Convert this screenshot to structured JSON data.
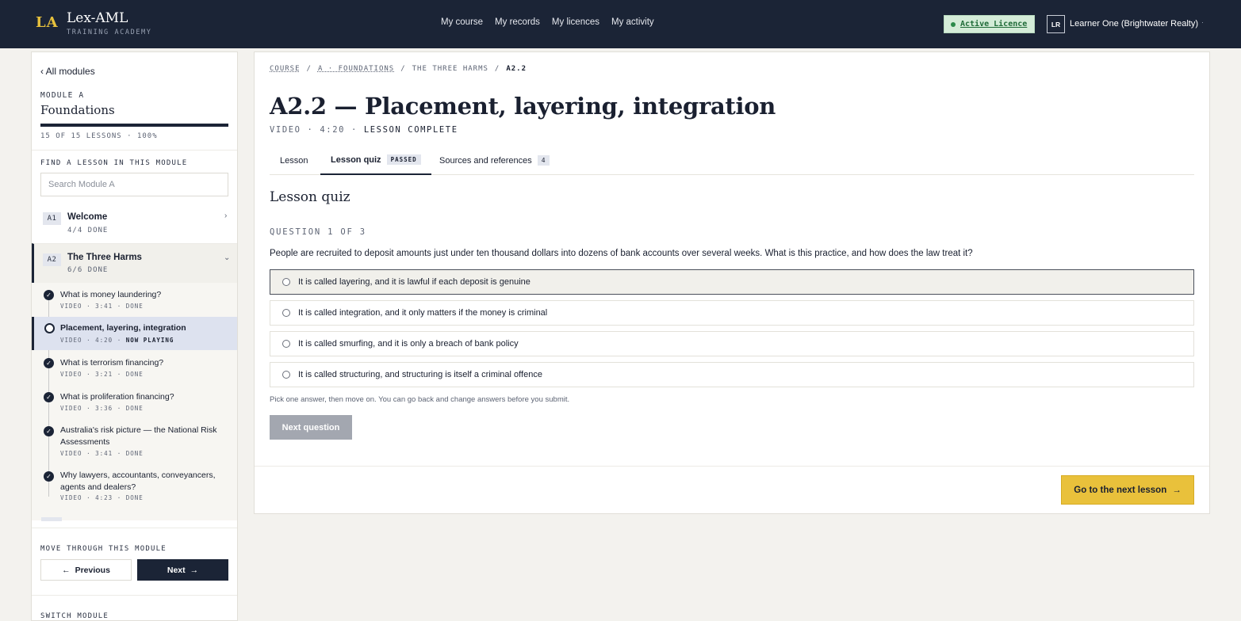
{
  "header": {
    "logo_mark": "LA",
    "brand_name": "Lex-AML",
    "brand_sub": "TRAINING ACADEMY",
    "nav": [
      "My course",
      "My records",
      "My licences",
      "My activity"
    ],
    "licence_badge": "Active Licence",
    "avatar_initials": "LR",
    "user_name": "Learner One (Brightwater Realty)",
    "user_caret": "·"
  },
  "sidebar": {
    "back_link": "‹  All modules",
    "module_kicker": "MODULE A",
    "module_title": "Foundations",
    "progress_fraction": 1.0,
    "progress_text": "15 OF 15 LESSONS  · 100%",
    "find_label": "FIND A LESSON IN THIS MODULE",
    "search_placeholder": "Search Module A",
    "groups": [
      {
        "code": "A1",
        "title": "Welcome",
        "meta": "4/4 DONE",
        "chevron": "›"
      },
      {
        "code": "A2",
        "title": "The Three Harms",
        "meta": "6/6 DONE",
        "chevron": "⌄"
      }
    ],
    "lessons": [
      {
        "title": "What is money laundering?",
        "meta": "VIDEO · 3:41 · DONE",
        "status": "done"
      },
      {
        "title": "Placement, layering, integration",
        "meta_prefix": "VIDEO · 4:20 · ",
        "meta_strong": "NOW PLAYING",
        "status": "current"
      },
      {
        "title": "What is terrorism financing?",
        "meta": "VIDEO · 3:21 · DONE",
        "status": "done"
      },
      {
        "title": "What is proliferation financing?",
        "meta": "VIDEO · 3:36 · DONE",
        "status": "done"
      },
      {
        "title": "Australia's risk picture — the National Risk Assessments",
        "meta": "VIDEO · 3:41 · DONE",
        "status": "done"
      },
      {
        "title": "Why lawyers, accountants, conveyancers, agents and dealers?",
        "meta": "VIDEO · 4:23 · DONE",
        "status": "done"
      }
    ],
    "move_label": "MOVE THROUGH THIS MODULE",
    "prev_label": "Previous",
    "next_label": "Next",
    "switch_label": "SWITCH MODULE"
  },
  "main": {
    "breadcrumb": [
      "COURSE",
      "A · FOUNDATIONS",
      "THE THREE HARMS",
      "A2.2"
    ],
    "breadcrumb_sep": "/",
    "title": "A2.2 — Placement, layering, integration",
    "meta_prefix": "VIDEO · 4:20  ·  ",
    "meta_status": "LESSON COMPLETE",
    "tabs": [
      {
        "label": "Lesson"
      },
      {
        "label": "Lesson quiz",
        "tag": "PASSED"
      },
      {
        "label": "Sources and references",
        "count": "4"
      }
    ],
    "quiz_heading": "Lesson quiz",
    "question_counter": "QUESTION 1 OF 3",
    "question": "People are recruited to deposit amounts just under ten thousand dollars into dozens of bank accounts over several weeks. What is this practice, and how does the law treat it?",
    "options": [
      "It is called layering, and it is lawful if each deposit is genuine",
      "It is called integration, and it only matters if the money is criminal",
      "It is called smurfing, and it is only a breach of bank policy",
      "It is called structuring, and structuring is itself a criminal offence"
    ],
    "hint": "Pick one answer, then move on. You can go back and change answers before you submit.",
    "next_question": "Next question",
    "go_next": "Go to the next lesson"
  },
  "colors": {
    "topbar": "#1b2436",
    "accent_yellow": "#e9c13b",
    "licence_green": "#2b8a4a",
    "active_lesson_bg": "#dde2ef"
  }
}
